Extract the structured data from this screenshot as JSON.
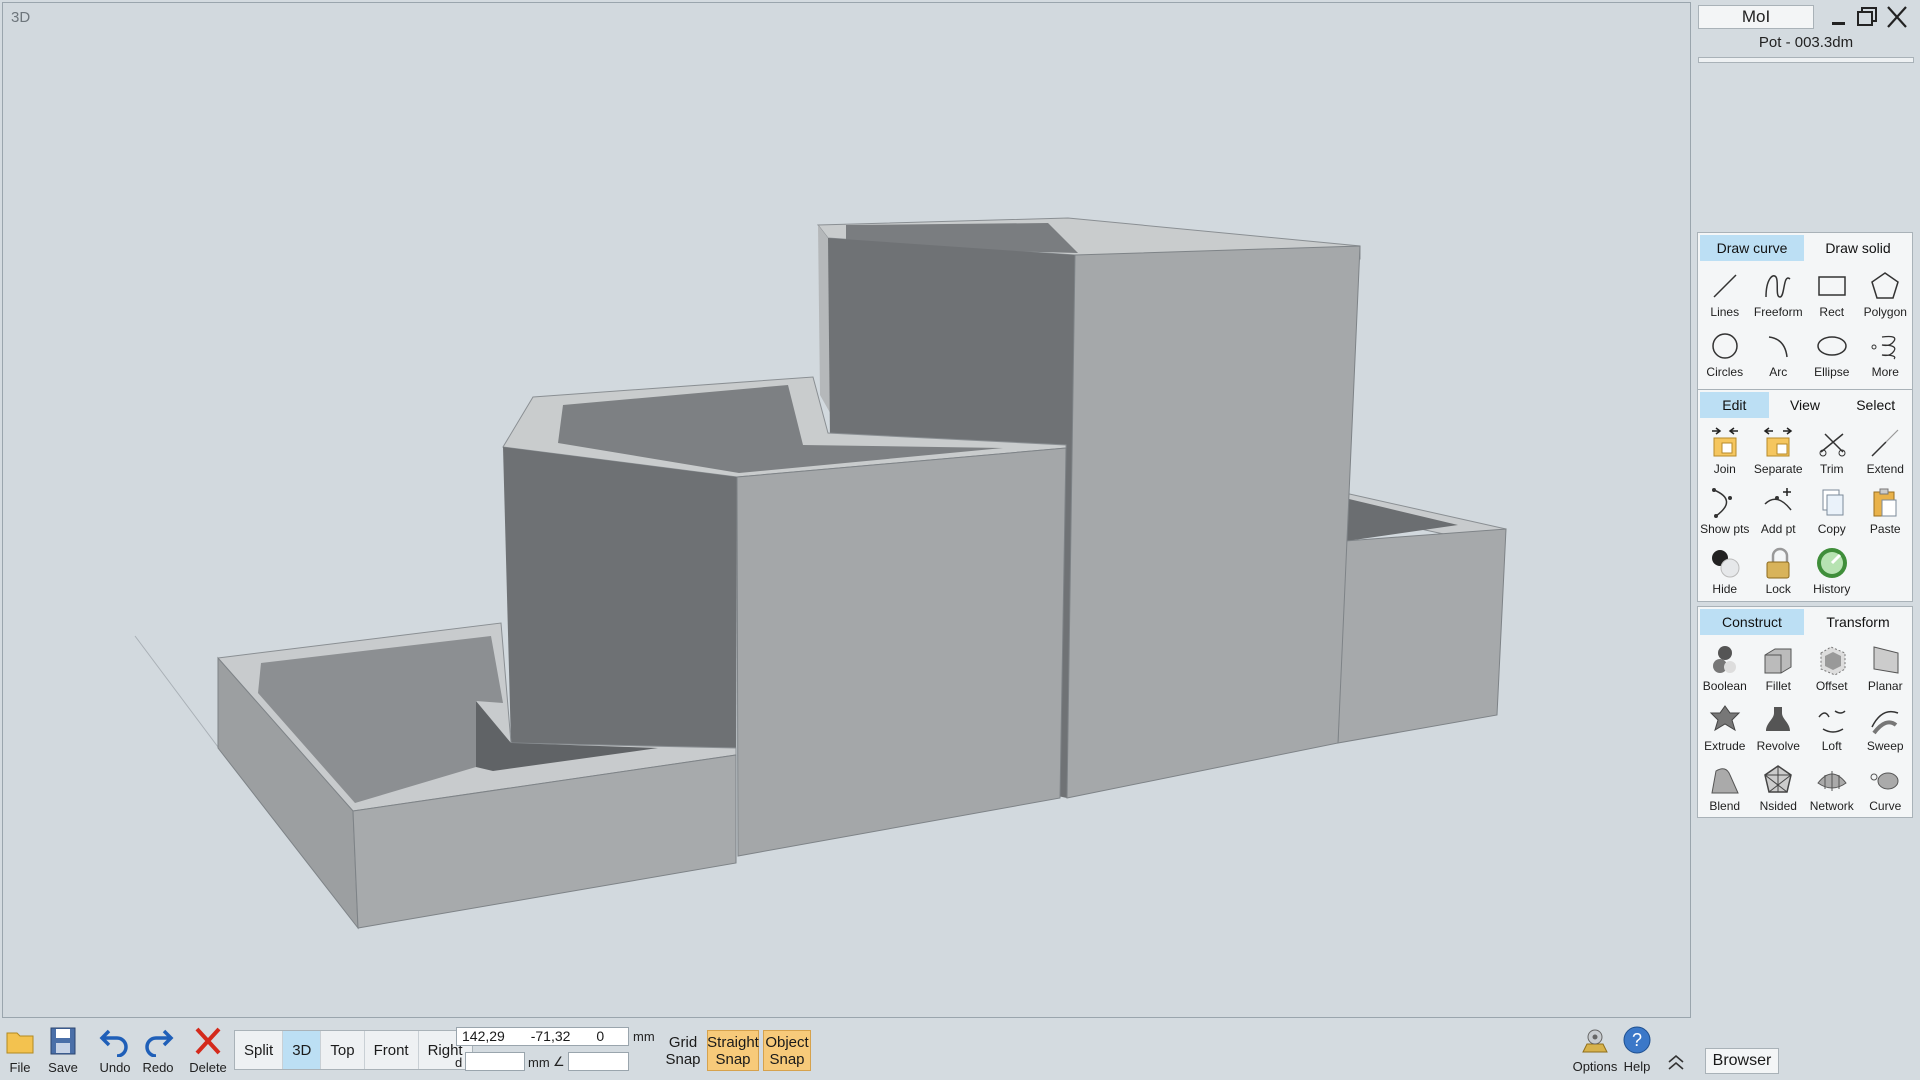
{
  "viewport": {
    "label": "3D"
  },
  "app": {
    "title": "MoI",
    "document": "Pot - 003.3dm"
  },
  "draw_group": {
    "tabs": [
      {
        "label": "Draw curve",
        "active": true
      },
      {
        "label": "Draw solid",
        "active": false
      }
    ],
    "tools": [
      {
        "label": "Lines",
        "icon": "line-icon"
      },
      {
        "label": "Freeform",
        "icon": "freeform-icon"
      },
      {
        "label": "Rect",
        "icon": "rectangle-icon"
      },
      {
        "label": "Polygon",
        "icon": "polygon-icon"
      },
      {
        "label": "Circles",
        "icon": "circle-icon"
      },
      {
        "label": "Arc",
        "icon": "arc-icon"
      },
      {
        "label": "Ellipse",
        "icon": "ellipse-icon"
      },
      {
        "label": "More",
        "icon": "spiral-icon"
      }
    ]
  },
  "edit_group": {
    "tabs": [
      {
        "label": "Edit",
        "active": true
      },
      {
        "label": "View",
        "active": false
      },
      {
        "label": "Select",
        "active": false
      }
    ],
    "tools": [
      {
        "label": "Join",
        "icon": "join-icon"
      },
      {
        "label": "Separate",
        "icon": "separate-icon"
      },
      {
        "label": "Trim",
        "icon": "scissors-icon"
      },
      {
        "label": "Extend",
        "icon": "extend-icon"
      },
      {
        "label": "Show pts",
        "icon": "show-points-icon"
      },
      {
        "label": "Add pt",
        "icon": "add-point-icon"
      },
      {
        "label": "Copy",
        "icon": "copy-icon"
      },
      {
        "label": "Paste",
        "icon": "paste-icon"
      },
      {
        "label": "Hide",
        "icon": "hide-icon"
      },
      {
        "label": "Lock",
        "icon": "lock-icon"
      },
      {
        "label": "History",
        "icon": "history-icon"
      }
    ]
  },
  "construct_group": {
    "tabs": [
      {
        "label": "Construct",
        "active": true
      },
      {
        "label": "Transform",
        "active": false
      }
    ],
    "tools": [
      {
        "label": "Boolean",
        "icon": "boolean-icon"
      },
      {
        "label": "Fillet",
        "icon": "fillet-icon"
      },
      {
        "label": "Offset",
        "icon": "offset-icon"
      },
      {
        "label": "Planar",
        "icon": "planar-icon"
      },
      {
        "label": "Extrude",
        "icon": "extrude-icon"
      },
      {
        "label": "Revolve",
        "icon": "revolve-icon"
      },
      {
        "label": "Loft",
        "icon": "loft-icon"
      },
      {
        "label": "Sweep",
        "icon": "sweep-icon"
      },
      {
        "label": "Blend",
        "icon": "blend-icon"
      },
      {
        "label": "Nsided",
        "icon": "nsided-icon"
      },
      {
        "label": "Network",
        "icon": "network-icon"
      },
      {
        "label": "Curve",
        "icon": "curve-icon"
      }
    ]
  },
  "bottom": {
    "file": "File",
    "save": "Save",
    "undo": "Undo",
    "redo": "Redo",
    "delete": "Delete",
    "views": [
      {
        "label": "Split",
        "active": false
      },
      {
        "label": "3D",
        "active": true
      },
      {
        "label": "Top",
        "active": false
      },
      {
        "label": "Front",
        "active": false
      },
      {
        "label": "Right",
        "active": false
      }
    ],
    "coords": {
      "x": "142,29",
      "y": "-71,32",
      "z": "0",
      "unit": "mm",
      "d_label": "d",
      "d_unit": "mm",
      "angle_label": "∠",
      "d_value": "",
      "angle_value": ""
    },
    "grid_snap": "Grid Snap",
    "straight_snap": "Straight Snap",
    "object_snap": "Object Snap",
    "options": "Options",
    "help": "Help",
    "browser": "Browser"
  },
  "colors": {
    "accent_tab": "#bcdff4",
    "snap_on": "#f7ca7a",
    "delete_red": "#d42a1c",
    "undo_blue": "#1f5fb8"
  }
}
